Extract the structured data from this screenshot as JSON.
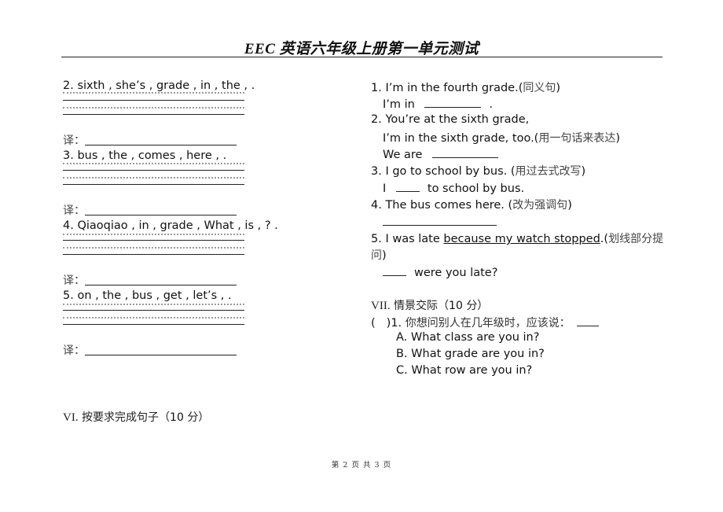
{
  "header": {
    "title": "EEC 英语六年级上册第一单元测试"
  },
  "left_column": {
    "items": [
      {
        "sentence": "2. sixth , she’s , grade , in , the , .",
        "translation_label": "译："
      },
      {
        "sentence": "3. bus , the , comes , here , .",
        "translation_label": "译："
      },
      {
        "sentence": "4. Qiaoqiao , in , grade , What , is , ? .",
        "translation_label": "译："
      },
      {
        "sentence": "5. on , the , bus , get , let’s , .",
        "translation_label": "译："
      }
    ],
    "section_vi": {
      "numeral": "VI.",
      "title": "按要求完成句子（",
      "points": "10",
      "unit": "分）"
    }
  },
  "right_column": {
    "questions": [
      {
        "line1_en": "1. I’m in the fourth grade.(",
        "line1_cn": "同义句",
        "line1_end": ")",
        "line2_pre": "I’m in",
        "line2_post": "."
      },
      {
        "line1_en": "2. You’re at the sixth grade,",
        "line2_en": "I’m in the sixth grade, too.(",
        "line2_cn": "用一句话来表达",
        "line2_end": ")",
        "line3_pre": "We are"
      },
      {
        "line1_en": "3. I go to school by bus. (",
        "line1_cn": "用过去式改写",
        "line1_end": ")",
        "line2_pre": "I",
        "line2_post": "to school by bus."
      },
      {
        "line1_en": "4. The bus comes here. (",
        "line1_cn": "改为强调句",
        "line1_end": ")"
      },
      {
        "line1_pre": "5. I was late ",
        "line1_underlined": "because my watch stopped",
        "line1_en_end": ".(",
        "line1_cn": "划线部分提",
        "line2_cn": "问",
        "line2_end": ")",
        "line3_post": "were you late?"
      }
    ],
    "section_vii": {
      "numeral": "VII.",
      "title": "情景交际（",
      "points": "10",
      "unit": "分）"
    },
    "situational": {
      "bracket_open": "(",
      "bracket_close": ")1.",
      "prompt": "你想问别人在几年级时，应该说：",
      "options": [
        "A.   What class are you in?",
        "B. What grade are you in?",
        "C. What row are you in?"
      ]
    }
  },
  "footer": {
    "page_label": "第 2 页 共 3 页"
  }
}
